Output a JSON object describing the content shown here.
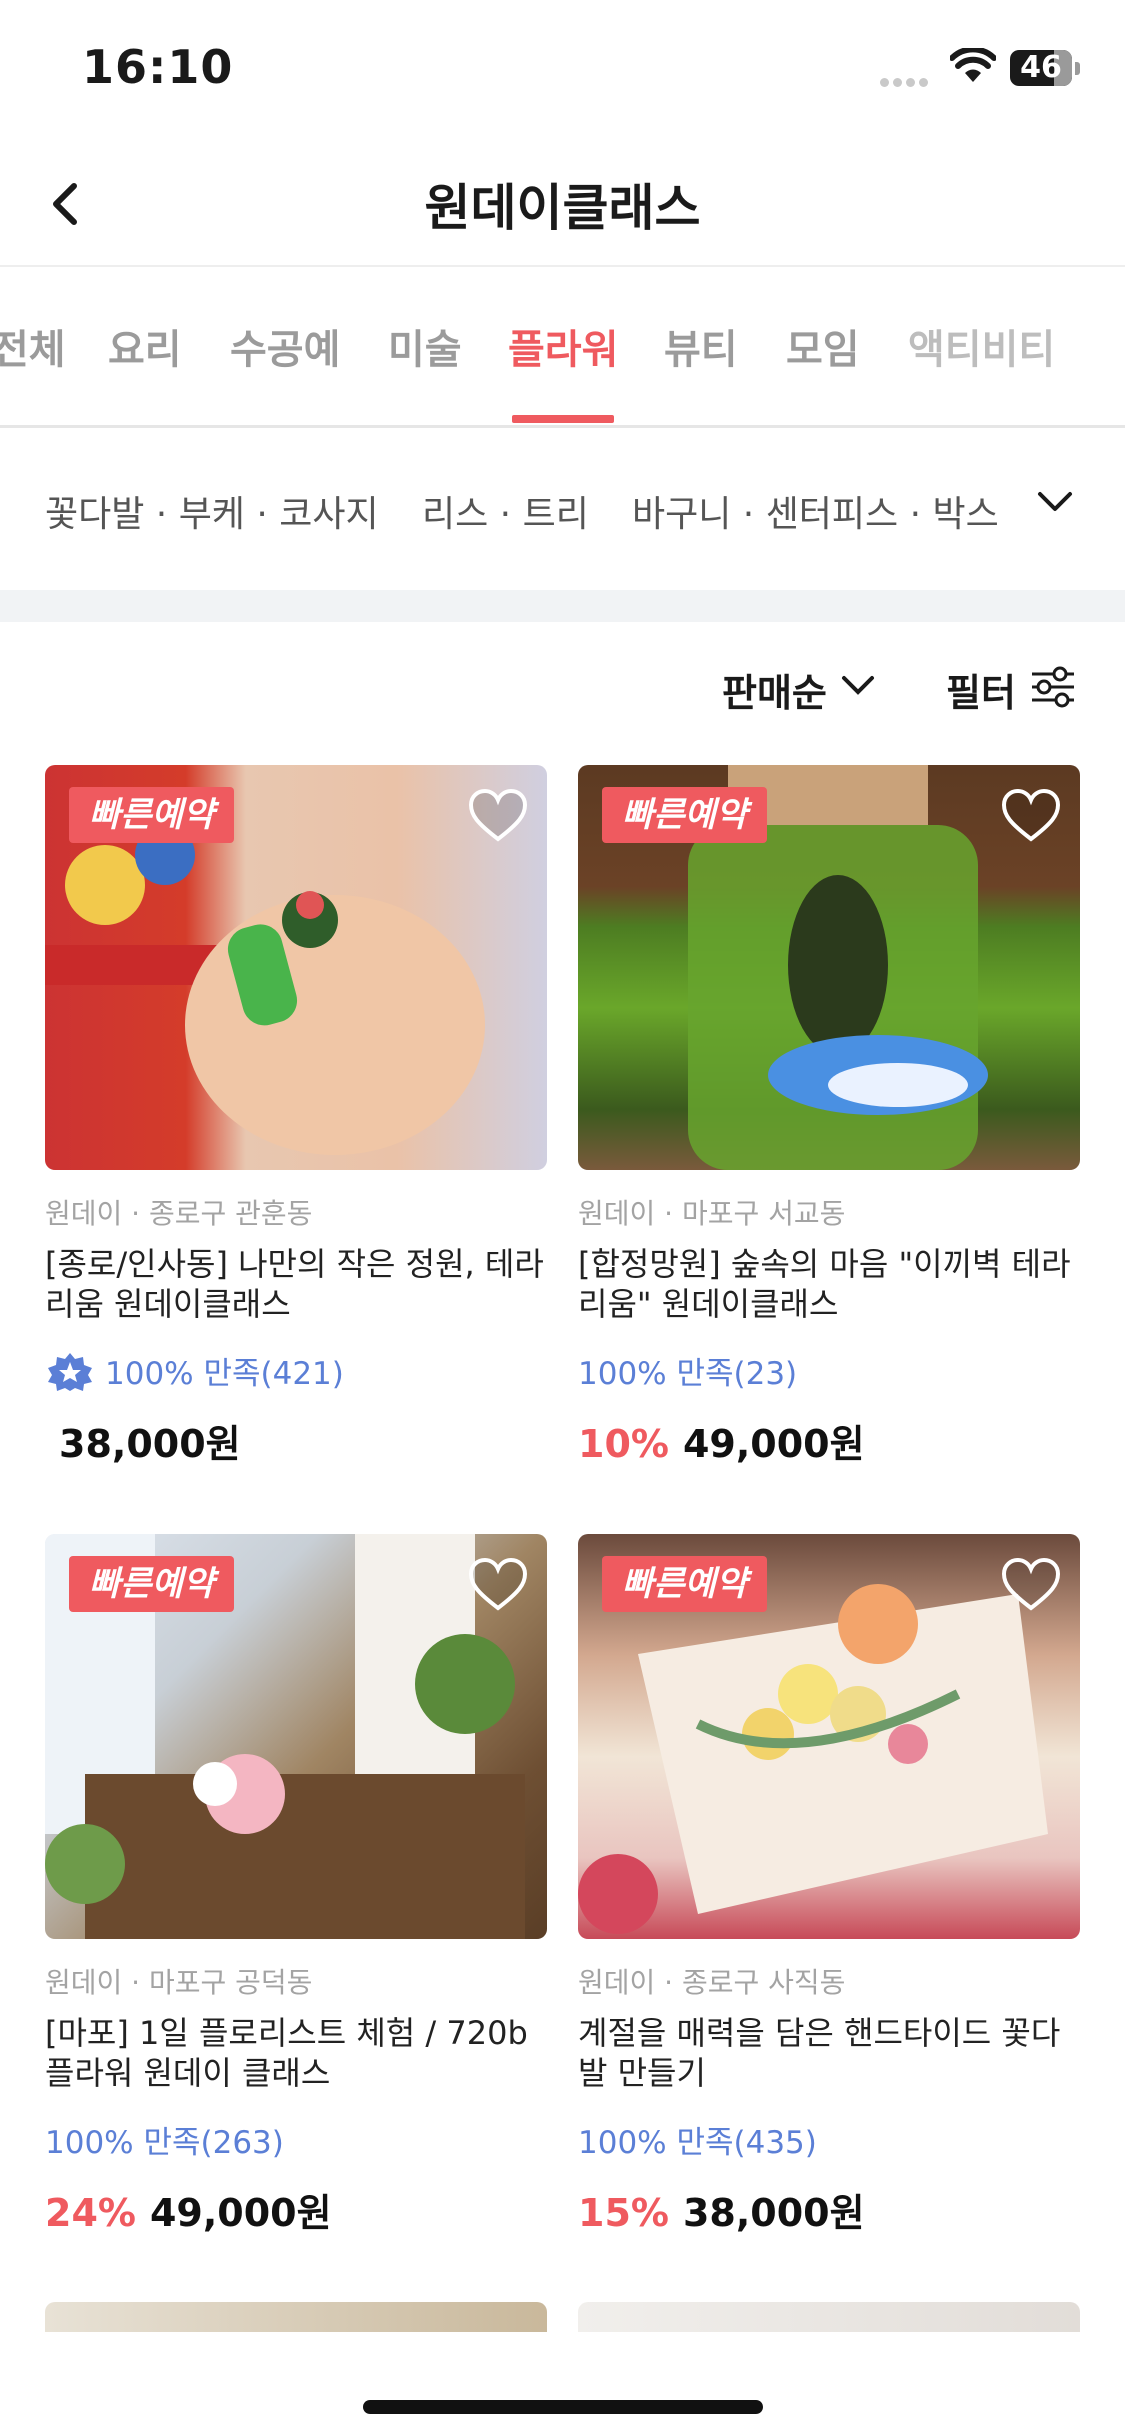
{
  "status": {
    "time": "16:10",
    "battery": "46"
  },
  "header": {
    "title": "원데이클래스"
  },
  "tabs": [
    {
      "label": "전체"
    },
    {
      "label": "요리"
    },
    {
      "label": "수공예"
    },
    {
      "label": "미술"
    },
    {
      "label": "플라워",
      "active": true
    },
    {
      "label": "뷰티"
    },
    {
      "label": "모임"
    },
    {
      "label": "액티비티"
    }
  ],
  "subcategories": [
    {
      "label": "꽃다발 · 부케 · 코사지"
    },
    {
      "label": "리스 · 트리"
    },
    {
      "label": "바구니 · 센터피스 · 박스"
    }
  ],
  "sortbar": {
    "sort_label": "판매순",
    "filter_label": "필터"
  },
  "colors": {
    "accent": "#ef5a5f",
    "rating": "#5b7fd6",
    "muted": "#a3a3a3"
  },
  "products": [
    {
      "badge": "빠른예약",
      "location": "원데이 · 종로구 관훈동",
      "name": "[종로/인사동] 나만의 작은 정원, 테라리움 원데이클래스",
      "rating": "100% 만족(421)",
      "discount": "",
      "price": "38,000원"
    },
    {
      "badge": "빠른예약",
      "location": "원데이 · 마포구 서교동",
      "name": "[합정망원] 숲속의 마음 \"이끼벽 테라리움\" 원데이클래스",
      "rating": "100% 만족(23)",
      "discount": "10%",
      "price": "49,000원"
    },
    {
      "badge": "빠른예약",
      "location": "원데이 · 마포구 공덕동",
      "name": "[마포] 1일 플로리스트 체험 / 720b 플라워 원데이 클래스",
      "rating": "100% 만족(263)",
      "discount": "24%",
      "price": "49,000원"
    },
    {
      "badge": "빠른예약",
      "location": "원데이 · 종로구 사직동",
      "name": "계절을 매력을 담은 핸드타이드 꽃다발 만들기",
      "rating": "100% 만족(435)",
      "discount": "15%",
      "price": "38,000원"
    }
  ]
}
